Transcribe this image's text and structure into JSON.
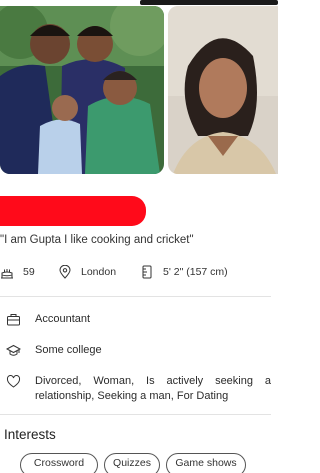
{
  "profile": {
    "bio": "\"I am Gupta I like cooking and cricket\"",
    "stats": {
      "age": "59",
      "location": "London",
      "height": "5' 2\" (157 cm)"
    },
    "details": {
      "occupation": "Accountant",
      "education": "Some college",
      "relationship": "Divorced, Woman, Is actively seeking a relationship, Seeking a man, For Dating"
    }
  },
  "interests": {
    "title": "Interests",
    "items": [
      "Crossword",
      "Quizzes",
      "Game shows"
    ]
  },
  "colors": {
    "redaction": "#ff0a1a",
    "divider": "#e3e3e3"
  },
  "icons": {
    "age": "cake-icon",
    "location": "location-pin-icon",
    "height": "ruler-icon",
    "work": "briefcase-icon",
    "education": "graduation-cap-icon",
    "relationship": "heart-icon"
  }
}
